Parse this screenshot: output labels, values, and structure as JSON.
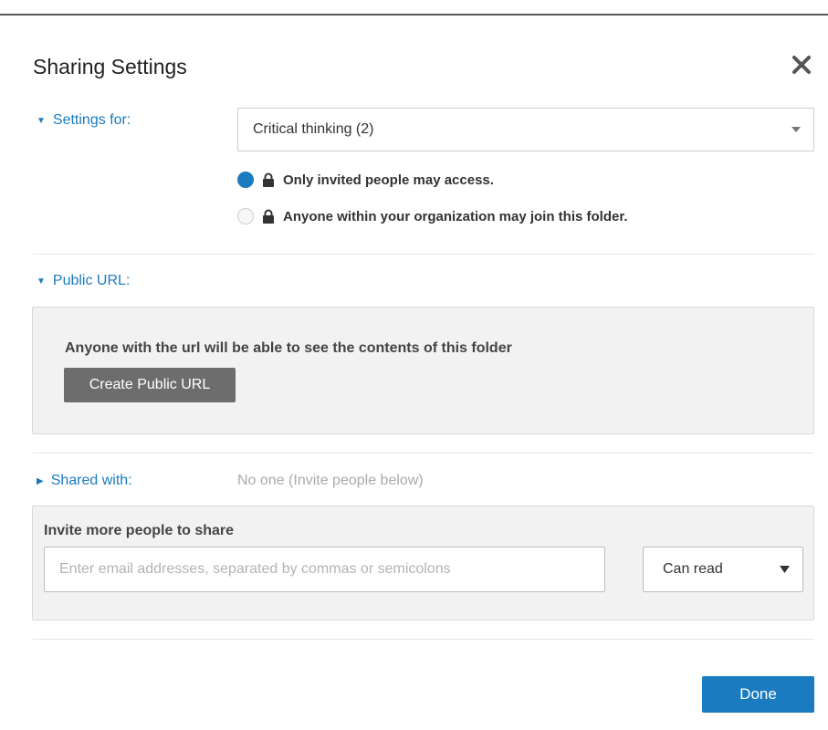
{
  "dialog": {
    "title": "Sharing Settings",
    "close_icon": "close-icon"
  },
  "settings_for": {
    "label": "Settings for:",
    "selected": "Critical thinking (2)",
    "options": [
      {
        "label": "Only invited people may access.",
        "checked": true,
        "icon": "lock-icon"
      },
      {
        "label": "Anyone within your organization may join this folder.",
        "checked": false,
        "icon": "lock-icon"
      }
    ]
  },
  "public_url": {
    "label": "Public URL:",
    "description": "Anyone with the url will be able to see the contents of this folder",
    "button_label": "Create Public URL"
  },
  "shared_with": {
    "label": "Shared with:",
    "value": "No one (Invite people below)"
  },
  "invite": {
    "heading": "Invite more people to share",
    "placeholder": "Enter email addresses, separated by commas or semicolons",
    "value": "",
    "permission": "Can read"
  },
  "footer": {
    "done_label": "Done"
  },
  "colors": {
    "accent": "#1a7bc0",
    "button_gray": "#6d6d6d",
    "panel_bg": "#f2f2f2"
  }
}
